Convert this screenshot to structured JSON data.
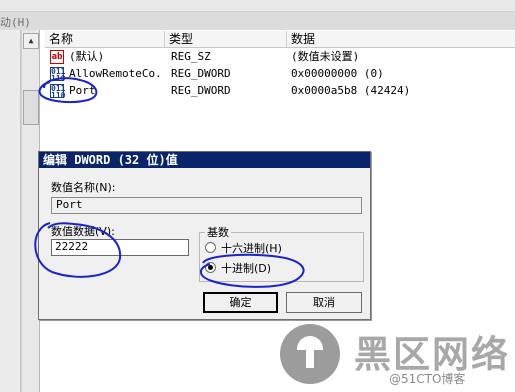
{
  "menu": {
    "truncated_text": "动(H)"
  },
  "list": {
    "headers": {
      "name": "名称",
      "type": "类型",
      "data": "数据"
    },
    "rows": [
      {
        "icon": "ab",
        "name": "(默认)",
        "type": "REG_SZ",
        "data": "(数值未设置)"
      },
      {
        "icon": "bin",
        "name": "AllowRemoteCo...",
        "type": "REG_DWORD",
        "data": "0x00000000 (0)"
      },
      {
        "icon": "bin",
        "name": "Port",
        "type": "REG_DWORD",
        "data": "0x0000a5b8 (42424)"
      }
    ]
  },
  "dialog": {
    "title": "编辑 DWORD (32 位)值",
    "value_name_label": "数值名称(N):",
    "value_name": "Port",
    "value_data_label": "数值数据(V):",
    "value_data": "22222",
    "base_label": "基数",
    "hex_label": "十六进制(H)",
    "dec_label": "十进制(D)",
    "selected_base": "decimal",
    "ok_label": "确定",
    "cancel_label": "取消"
  },
  "watermark": {
    "big": "黑区网络",
    "small": "@51CTO博客"
  },
  "colors": {
    "title_bar": "#0a246a",
    "annotation": "#1a24c8",
    "icon_string": "#c40000",
    "icon_binary": "#1a3e8a"
  }
}
